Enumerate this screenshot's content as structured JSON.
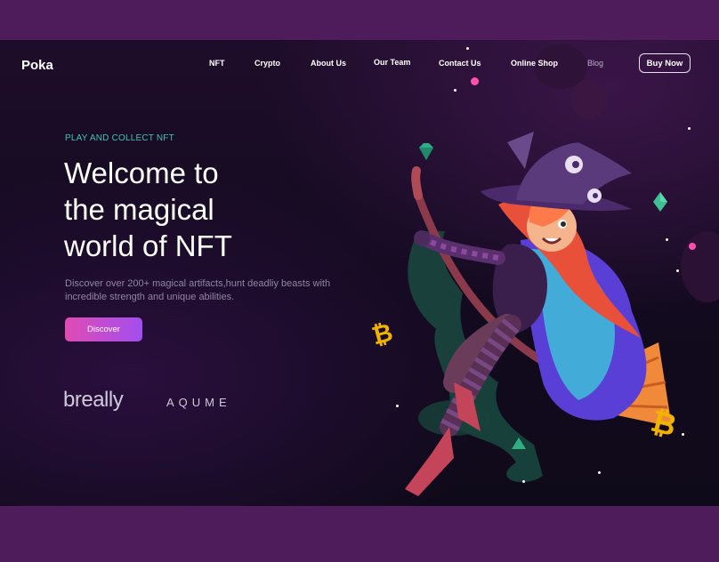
{
  "header": {
    "logo": "Poka",
    "nav": [
      "NFT",
      "Crypto",
      "About Us",
      "Our Team",
      "Contact Us",
      "Online Shop",
      "Blog"
    ],
    "cta_label": "Buy Now"
  },
  "hero": {
    "eyebrow": "PLAY AND COLLECT NFT",
    "title_lines": [
      "Welcome to",
      "the magical",
      "world of NFT"
    ],
    "description": "Discover over 200+ magical artifacts,hunt deadliy beasts with incredible strength and unique abilities.",
    "button_label": "Discover"
  },
  "partners": [
    "breally",
    "AQUME"
  ],
  "colors": {
    "outer_bg": "#4e1b5b",
    "page_bg": "#120a1e",
    "accent_teal": "#3fc4b3",
    "button_gradient_start": "#e04bb3",
    "button_gradient_end": "#a24ef0",
    "coin": "#f0b400"
  },
  "icons": [
    "bitcoin-icon",
    "gem-icon",
    "witch-illustration"
  ]
}
